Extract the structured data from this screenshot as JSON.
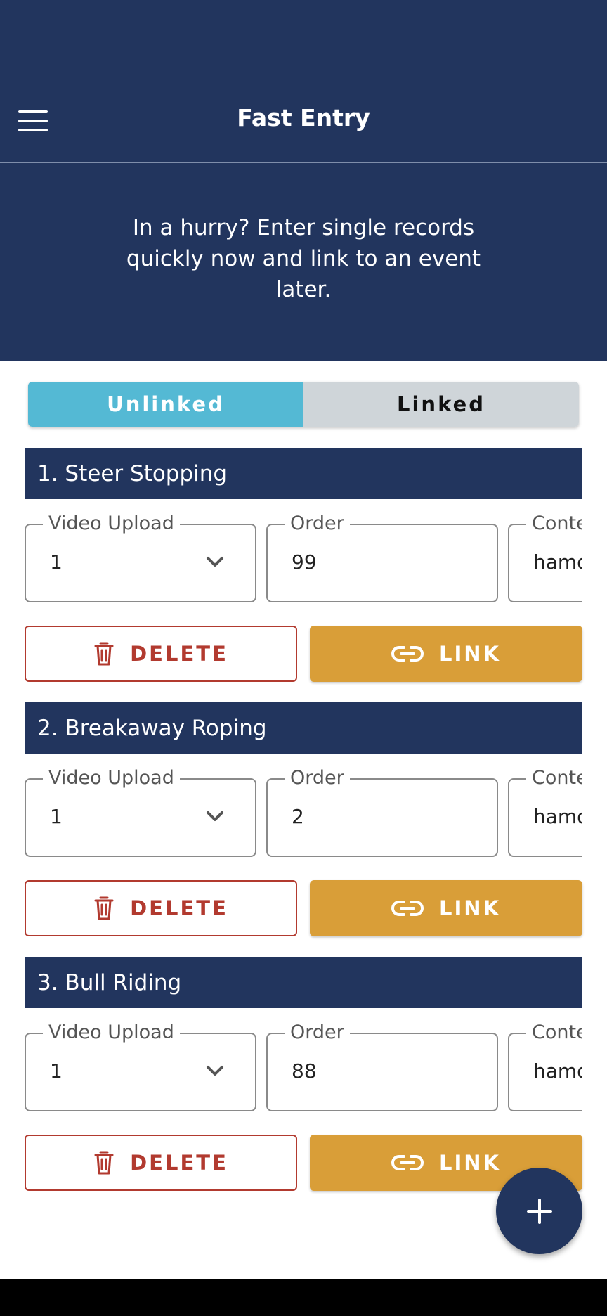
{
  "header": {
    "title": "Fast Entry",
    "subtitle": "In a hurry? Enter single records quickly now and link to an event later.",
    "menu_icon": "hamburger-menu-icon"
  },
  "tabs": [
    {
      "label": "Unlinked",
      "active": true
    },
    {
      "label": "Linked",
      "active": false
    }
  ],
  "records": [
    {
      "title": "1. Steer Stopping",
      "video_upload_label": "Video Upload",
      "video_upload_value": "1",
      "order_label": "Order",
      "order_value": "99",
      "contestant_label": "Conte",
      "contestant_value": "hamd"
    },
    {
      "title": "2. Breakaway Roping",
      "video_upload_label": "Video Upload",
      "video_upload_value": "1",
      "order_label": "Order",
      "order_value": "2",
      "contestant_label": "Conte",
      "contestant_value": "hamd"
    },
    {
      "title": "3. Bull Riding",
      "video_upload_label": "Video Upload",
      "video_upload_value": "1",
      "order_label": "Order",
      "order_value": "88",
      "contestant_label": "Conte",
      "contestant_value": "hamd"
    }
  ],
  "buttons": {
    "delete_label": "DELETE",
    "link_label": "LINK"
  },
  "colors": {
    "primary": "#22355e",
    "tab_active": "#54b9d4",
    "tab_inactive": "#cfd5d9",
    "delete": "#b23a2f",
    "link": "#d99e38"
  }
}
